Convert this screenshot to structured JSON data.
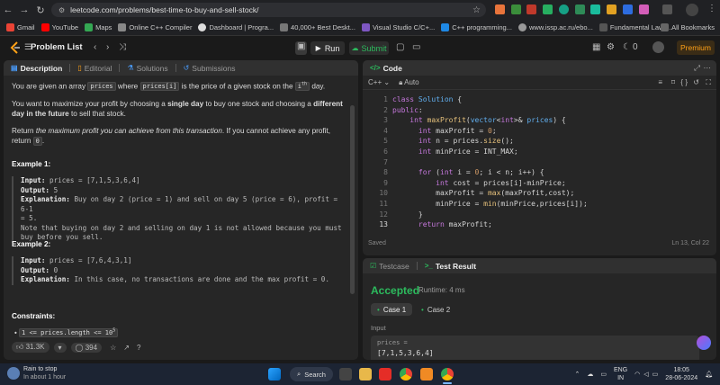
{
  "browser": {
    "url": "leetcode.com/problems/best-time-to-buy-and-sell-stock/",
    "bookmarks": [
      "Gmail",
      "YouTube",
      "Maps",
      "Online C++ Compiler",
      "Dashboard | Progra...",
      "40,000+ Best Deskt...",
      "Visual Studio C/C+...",
      "C++ programming...",
      "www.issp.ac.ru/ebo...",
      "Fundamental Laws...",
      "All Bookmarks"
    ]
  },
  "lc_top": {
    "problem_list": "Problem List",
    "run": "Run",
    "submit": "Submit",
    "streak": "0",
    "premium": "Premium"
  },
  "desc_tabs": [
    "Description",
    "Editorial",
    "Solutions",
    "Submissions"
  ],
  "description": {
    "p1_a": "You are given an array ",
    "p1_code1": "prices",
    "p1_b": " where ",
    "p1_code2": "prices[i]",
    "p1_c": " is the price of a given stock on the ",
    "p1_code3": "i",
    "p1_sup": "th",
    "p1_d": " day.",
    "p2_a": "You want to maximize your profit by choosing a ",
    "p2_b1": "single day",
    "p2_b": " to buy one stock and choosing a ",
    "p2_b2": "different day in the future",
    "p2_c": " to sell that stock.",
    "p3_a": "Return ",
    "p3_i": "the maximum profit you can achieve from this transaction",
    "p3_b": ". If you cannot achieve any profit, return ",
    "p3_code": "0",
    "p3_c": "."
  },
  "example1": {
    "title": "Example 1:",
    "input_label": "Input:",
    "input": "prices = [7,1,5,3,6,4]",
    "output_label": "Output:",
    "output": "5",
    "expl_label": "Explanation:",
    "expl_line1": "Buy on day 2 (price = 1) and sell on day 5 (price = 6), profit = 6-1",
    "expl_line2": "= 5.",
    "note_line1": "Note that buying on day 2 and selling on day 1 is not allowed because you must",
    "note_line2": "buy before you sell."
  },
  "example2": {
    "title": "Example 2:",
    "input_label": "Input:",
    "input": "prices = [7,6,4,3,1]",
    "output_label": "Output:",
    "output": "0",
    "expl_label": "Explanation:",
    "expl": "In this case, no transactions are done and the max profit = 0."
  },
  "constraints": {
    "title": "Constraints:",
    "item1": "1 <= prices.length <= 10",
    "item1_sup": "5"
  },
  "desc_footer": {
    "likes": "31.3K",
    "comments": "394"
  },
  "code_panel": {
    "title": "Code",
    "language": "C++",
    "mode": "Auto",
    "saved": "Saved",
    "cursor": "Ln 13, Col 22"
  },
  "result_panel": {
    "tab1": "Testcase",
    "tab2": "Test Result",
    "status": "Accepted",
    "runtime": "Runtime: 4 ms",
    "case1": "Case 1",
    "case2": "Case 2",
    "input_label": "Input",
    "var": "prices =",
    "value": "[7,1,5,3,6,4]"
  },
  "taskbar": {
    "weather_title": "Rain to stop",
    "weather_sub": "In about 1 hour",
    "search": "Search",
    "lang1": "ENG",
    "lang2": "IN",
    "time": "18:05",
    "date": "28-06-2024"
  },
  "colors": {
    "accepted": "#2cbb5d",
    "premium": "#ffa116",
    "keyword": "#c678dd",
    "type": "#61afef"
  }
}
